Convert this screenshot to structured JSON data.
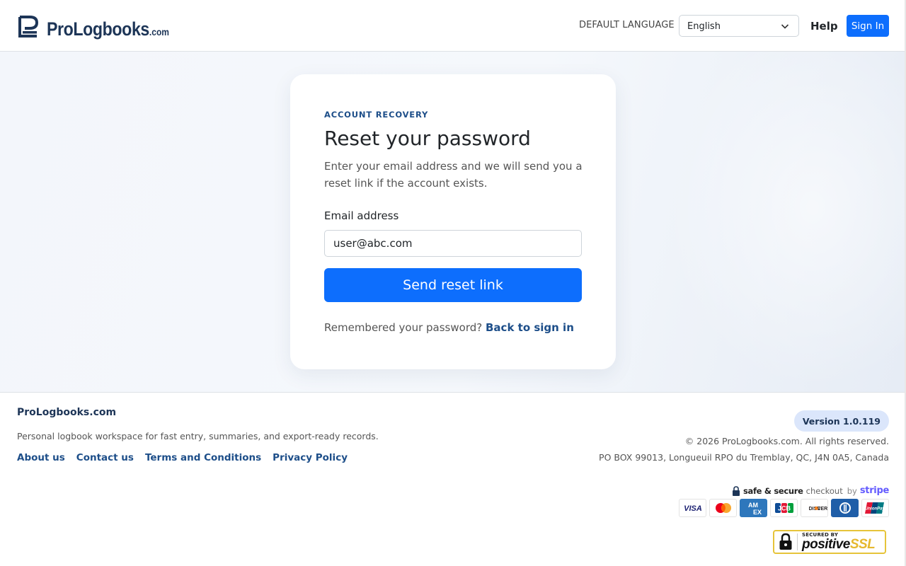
{
  "header": {
    "logo": {
      "text": "ProLogbooks",
      "suffix": ".com"
    },
    "language_label": "DEFAULT LANGUAGE",
    "language_value": "English",
    "help_label": "Help",
    "signin_label": "Sign In"
  },
  "card": {
    "eyebrow": "ACCOUNT RECOVERY",
    "title": "Reset your password",
    "description": "Enter your email address and we will send you a reset link if the account exists.",
    "email_label": "Email address",
    "email_value": "user@abc.com",
    "submit_label": "Send reset link",
    "remember_text": "Remembered your password?",
    "back_link": "Back to sign in"
  },
  "footer": {
    "brand": "ProLogbooks.com",
    "tagline": "Personal logbook workspace for fast entry, summaries, and export-ready records.",
    "links": [
      "About us",
      "Contact us",
      "Terms and Conditions",
      "Privacy Policy"
    ],
    "version": "Version 1.0.119",
    "copyright": "© 2026 ProLogbooks.com. All rights reserved.",
    "address": "PO BOX 99013, Longueuil RPO du Tremblay, QC, J4N 0A5, Canada",
    "stripe": {
      "safe": "safe & secure",
      "checkout": "checkout",
      "by": "by",
      "brand": "stripe"
    },
    "payment_icons": [
      "visa-icon",
      "mastercard-icon",
      "amex-icon",
      "jcb-icon",
      "discover-icon",
      "diners-icon",
      "unionpay-icon"
    ],
    "ssl": {
      "secured_by": "SECURED BY",
      "positive": "positive",
      "ssl": "SSL"
    }
  },
  "colors": {
    "primary": "#0d6efd",
    "brand_navy": "#1d3557",
    "link": "#1d4e89"
  }
}
